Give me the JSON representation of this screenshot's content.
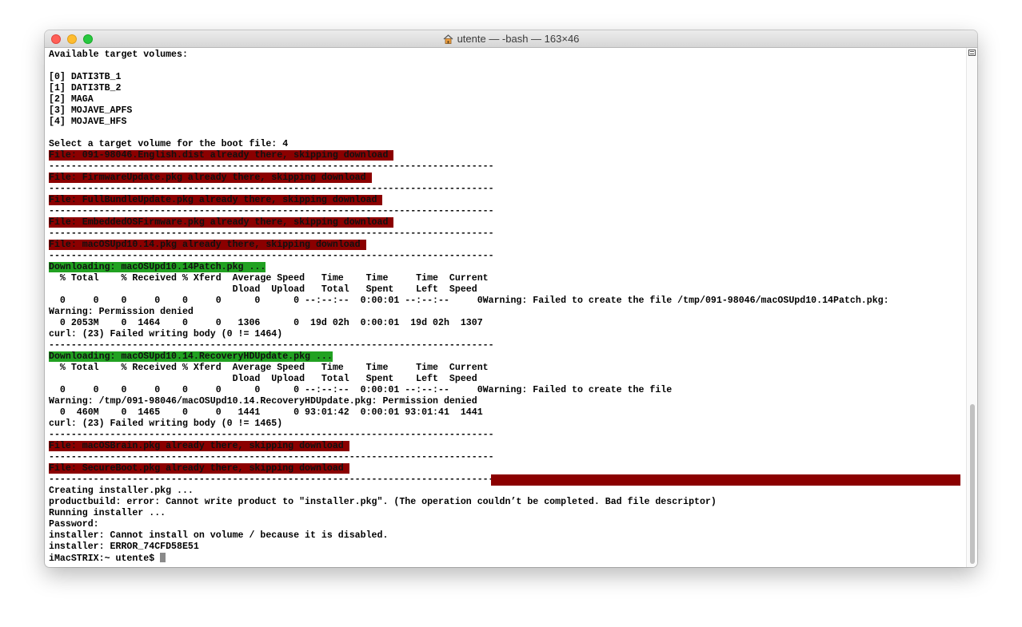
{
  "window": {
    "title": "utente — -bash — 163×46"
  },
  "terminal": {
    "lines": [
      {
        "text": "Available target volumes:"
      },
      {
        "text": ""
      },
      {
        "text": "[0] DATI3TB_1"
      },
      {
        "text": "[1] DATI3TB_2"
      },
      {
        "text": "[2] MAGA"
      },
      {
        "text": "[3] MOJAVE_APFS"
      },
      {
        "text": "[4] MOJAVE_HFS"
      },
      {
        "text": ""
      },
      {
        "text": "Select a target volume for the boot file: 4"
      },
      {
        "text": "File: 091-98046.English.dist already there, skipping download ",
        "hl": "red"
      },
      {
        "text": "--------------------------------------------------------------------------------"
      },
      {
        "text": "File: FirmwareUpdate.pkg already there, skipping download ",
        "hl": "red"
      },
      {
        "text": "--------------------------------------------------------------------------------"
      },
      {
        "text": "File: FullBundleUpdate.pkg already there, skipping download ",
        "hl": "red"
      },
      {
        "text": "--------------------------------------------------------------------------------"
      },
      {
        "text": "File: EmbeddedOSFirmware.pkg already there, skipping download ",
        "hl": "red"
      },
      {
        "text": "--------------------------------------------------------------------------------"
      },
      {
        "text": "File: macOSUpd10.14.pkg already there, skipping download ",
        "hl": "red"
      },
      {
        "text": "--------------------------------------------------------------------------------"
      },
      {
        "text": "Downloading: macOSUpd10.14Patch.pkg ...",
        "hl": "green"
      },
      {
        "text": "  % Total    % Received % Xferd  Average Speed   Time    Time     Time  Current"
      },
      {
        "text": "                                 Dload  Upload   Total   Spent    Left  Speed"
      },
      {
        "text": "  0     0    0     0    0     0      0      0 --:--:--  0:00:01 --:--:--     0Warning: Failed to create the file /tmp/091-98046/macOSUpd10.14Patch.pkg:"
      },
      {
        "text": "Warning: Permission denied"
      },
      {
        "text": "  0 2053M    0  1464    0     0   1306      0  19d 02h  0:00:01  19d 02h  1307"
      },
      {
        "text": "curl: (23) Failed writing body (0 != 1464)"
      },
      {
        "text": "--------------------------------------------------------------------------------"
      },
      {
        "text": "Downloading: macOSUpd10.14.RecoveryHDUpdate.pkg ...",
        "hl": "green"
      },
      {
        "text": "  % Total    % Received % Xferd  Average Speed   Time    Time     Time  Current"
      },
      {
        "text": "                                 Dload  Upload   Total   Spent    Left  Speed"
      },
      {
        "text": "  0     0    0     0    0     0      0      0 --:--:--  0:00:01 --:--:--     0Warning: Failed to create the file"
      },
      {
        "text": "Warning: /tmp/091-98046/macOSUpd10.14.RecoveryHDUpdate.pkg: Permission denied"
      },
      {
        "text": "  0  460M    0  1465    0     0   1441      0 93:01:42  0:00:01 93:01:41  1441"
      },
      {
        "text": "curl: (23) Failed writing body (0 != 1465)"
      },
      {
        "text": "--------------------------------------------------------------------------------"
      },
      {
        "text": "File: macOSBrain.pkg already there, skipping download ",
        "hl": "red"
      },
      {
        "text": "--------------------------------------------------------------------------------"
      },
      {
        "text": "File: SecureBoot.pkg already there, skipping download ",
        "hl": "red"
      },
      {
        "text": "--------------------------------------------------------------------------------",
        "redbar": true
      },
      {
        "text": "Creating installer.pkg ..."
      },
      {
        "text": "productbuild: error: Cannot write product to \"installer.pkg\". (The operation couldn’t be completed. Bad file descriptor)"
      },
      {
        "text": "Running installer ..."
      },
      {
        "text": "Password:"
      },
      {
        "text": "installer: Cannot install on volume / because it is disabled."
      },
      {
        "text": "installer: ERROR_74CFD58E51"
      },
      {
        "text": "iMacSTRIX:~ utente$ ",
        "cursor": true
      }
    ]
  },
  "colors": {
    "error_highlight": "#8b0000",
    "download_highlight": "#21a121",
    "close": "#ff5f57",
    "minimize": "#febc2e",
    "zoom": "#28c840"
  },
  "icons": {
    "title_icon": "home-icon",
    "scroll_top_icon": "split-pane-icon"
  }
}
